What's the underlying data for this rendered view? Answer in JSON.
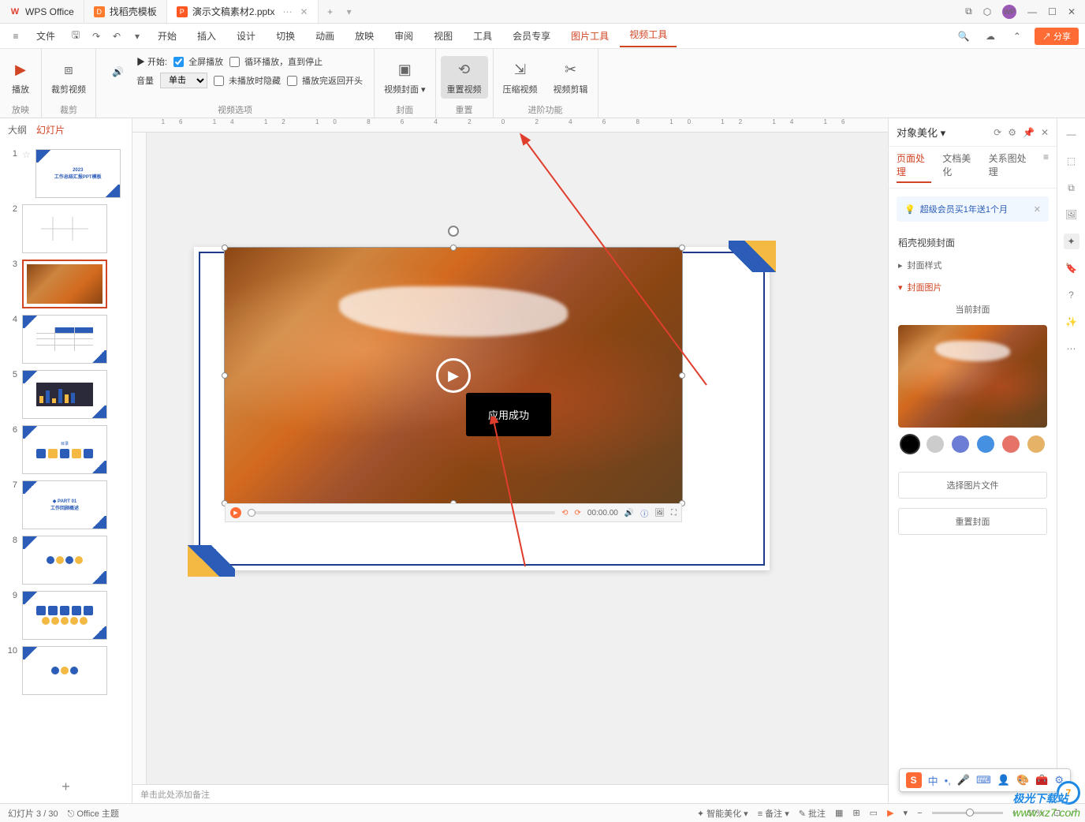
{
  "titlebar": {
    "tabs": [
      {
        "icon": "W",
        "label": "WPS Office"
      },
      {
        "icon": "D",
        "label": "找稻壳模板"
      },
      {
        "icon": "P",
        "label": "演示文稿素材2.pptx"
      }
    ],
    "new_tab": "+"
  },
  "menubar": {
    "file": "文件",
    "items": [
      "开始",
      "插入",
      "设计",
      "切换",
      "动画",
      "放映",
      "审阅",
      "视图",
      "工具",
      "会员专享"
    ],
    "context_items": [
      "图片工具",
      "视频工具"
    ],
    "active": "视频工具",
    "share": "分享"
  },
  "ribbon": {
    "play": {
      "label": "播放",
      "group": "放映"
    },
    "crop": {
      "label": "裁剪视频",
      "group": "裁剪"
    },
    "volume": "音量",
    "start_label": "开始:",
    "start_value": "单击",
    "fullscreen": "全屏播放",
    "loop": "循环播放，直到停止",
    "hide": "未播放时隐藏",
    "rewind": "播放完返回开头",
    "options_group": "视频选项",
    "cover": {
      "label": "视频封面",
      "group": "封面"
    },
    "reset": {
      "label": "重置视频",
      "group": "重置"
    },
    "compress": "压缩视频",
    "clip": "视频剪辑",
    "advanced_group": "进阶功能"
  },
  "slide_panel": {
    "tabs": {
      "outline": "大纲",
      "slides": "幻灯片"
    },
    "slides": [
      {
        "n": "1"
      },
      {
        "n": "2"
      },
      {
        "n": "3"
      },
      {
        "n": "4"
      },
      {
        "n": "5"
      },
      {
        "n": "6"
      },
      {
        "n": "7"
      },
      {
        "n": "8"
      },
      {
        "n": "9"
      },
      {
        "n": "10"
      }
    ]
  },
  "canvas": {
    "toast": "应用成功",
    "video_time": "00:00.00",
    "notes_placeholder": "单击此处添加备注"
  },
  "right_panel": {
    "title": "对象美化",
    "tabs": {
      "page": "页面处理",
      "text": "文档美化",
      "diagram": "关系图处理"
    },
    "banner": "超级会员买1年送1个月",
    "section1": "稻壳视频封面",
    "row_style": "封面样式",
    "row_image": "封面图片",
    "cover_label": "当前封面",
    "colors": [
      "#000000",
      "#cccccc",
      "#6b7dd4",
      "#4590e0",
      "#e57368",
      "#e5b368"
    ],
    "btn_select": "选择图片文件",
    "btn_reset": "重置封面"
  },
  "statusbar": {
    "slide_info": "幻灯片 3 / 30",
    "theme": "Office 主题",
    "smart": "智能美化",
    "notes": "备注",
    "comments": "批注",
    "zoom": "60%"
  },
  "ime": {
    "mode": "中"
  },
  "watermark": {
    "site": "www.xz7.com",
    "name": "极光下载站"
  }
}
